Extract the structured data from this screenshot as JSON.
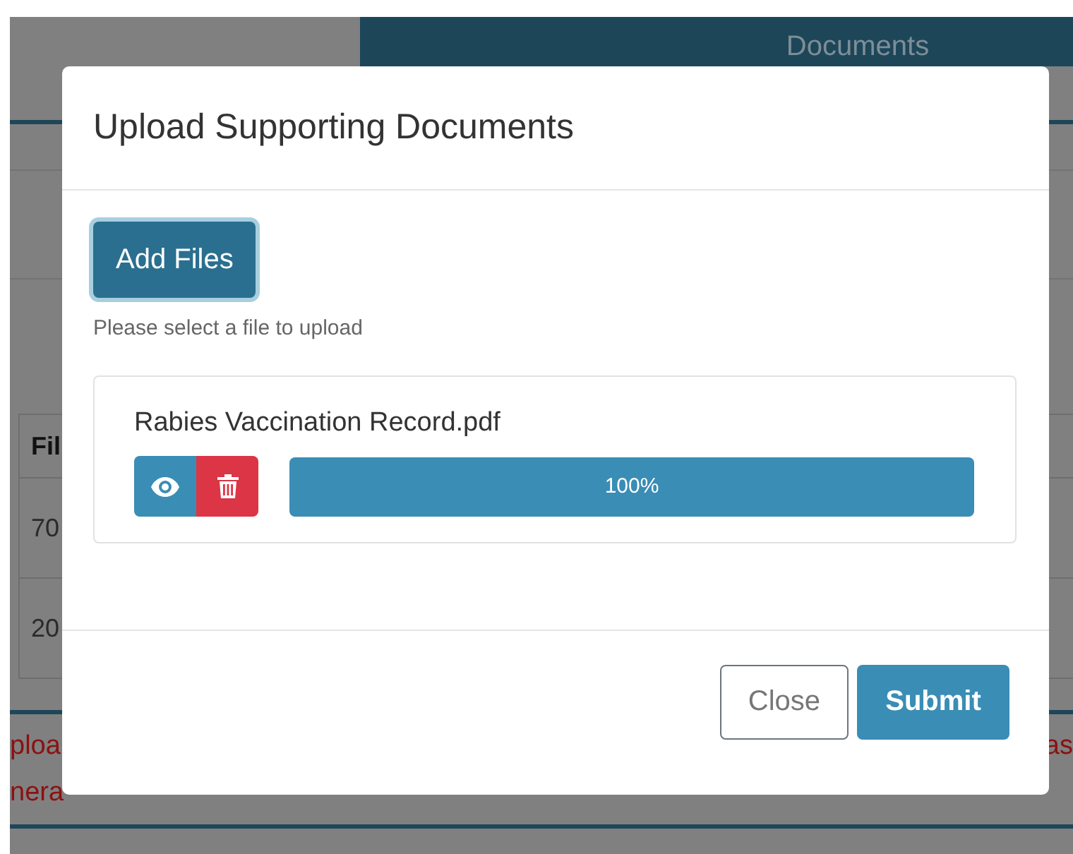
{
  "background": {
    "tab": "Documents",
    "table": {
      "header": "Fil",
      "rows": [
        "70",
        "20"
      ]
    },
    "notice_left": [
      "ploa",
      "nera"
    ],
    "notice_right": "as"
  },
  "modal": {
    "title": "Upload Supporting Documents",
    "add_button": "Add Files",
    "hint": "Please select a file to upload",
    "files": [
      {
        "name": "Rabies Vaccination Record.pdf",
        "level": 1,
        "reading": "100%"
      }
    ],
    "buttons": [
      {
        "label": "Close",
        "kind": "secondary"
      },
      {
        "label": "Submit",
        "kind": "primary"
      }
    ]
  }
}
